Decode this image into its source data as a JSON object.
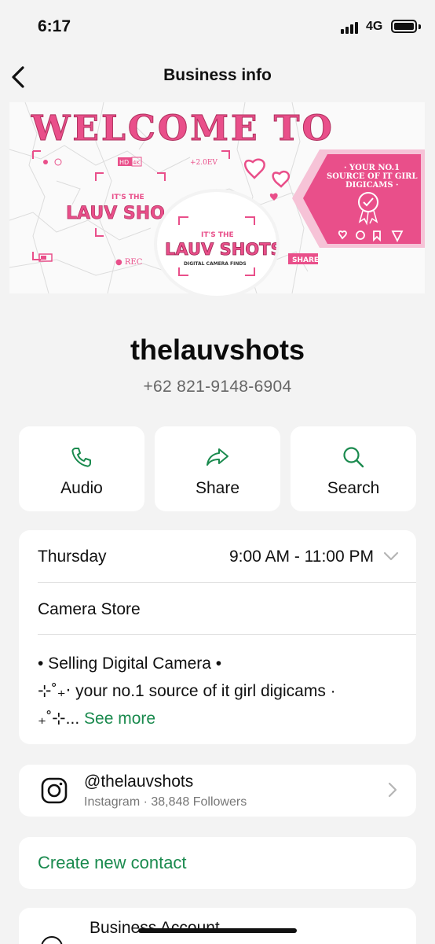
{
  "status_bar": {
    "time": "6:17",
    "network": "4G"
  },
  "nav": {
    "title": "Business info"
  },
  "cover": {
    "headline": "WELCOME TO",
    "brand_top": "IT'S THE",
    "brand_main": "LAUV SHOTS",
    "brand_tagline": "DIGITAL CAMERA FINDS",
    "badge_text_1": "· YOUR NO.1",
    "badge_text_2": "SOURCE OF IT GIRL",
    "badge_text_3": "DIGICAMS ·",
    "hud_hd": "HD",
    "hud_4k": "4K",
    "hud_ev": "+2.0EV",
    "hud_rec": "● REC",
    "hud_share": "SHARE",
    "accent_color": "#e94f8a"
  },
  "profile": {
    "name": "thelauvshots",
    "phone": "+62 821-9148-6904"
  },
  "actions": [
    {
      "label": "Audio",
      "icon": "phone-icon"
    },
    {
      "label": "Share",
      "icon": "share-arrow-icon"
    },
    {
      "label": "Search",
      "icon": "search-icon"
    }
  ],
  "info": {
    "day": "Thursday",
    "hours": "9:00 AM - 11:00 PM",
    "category": "Camera Store",
    "desc_line1": "• Selling Digital Camera •",
    "desc_line2": "⊹˚₊‧ your no.1 source of it girl digicams ·",
    "desc_line3": "₊˚⊹...",
    "see_more": "See more"
  },
  "instagram": {
    "handle": "@thelauvshots",
    "subtitle": "Instagram · 38,848 Followers"
  },
  "contact": {
    "label": "Create new contact"
  },
  "business": {
    "label": "Business Account"
  },
  "colors": {
    "accent_green": "#1a8a4e",
    "background": "#f3f3f3"
  }
}
